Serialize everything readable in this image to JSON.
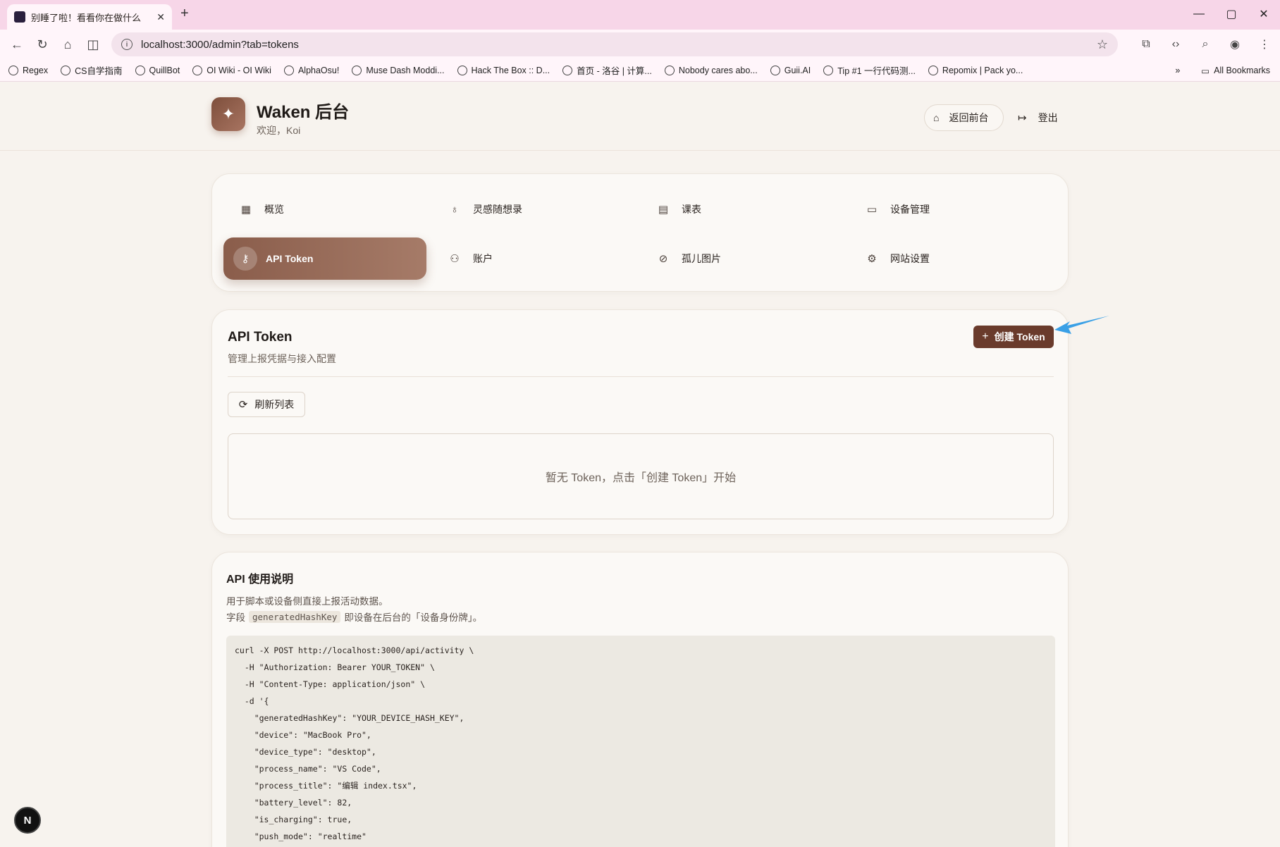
{
  "browser": {
    "tab_title": "别睡了啦！看看你在做什么",
    "url": "localhost:3000/admin?tab=tokens",
    "bookmarks": [
      "Regex",
      "CS自学指南",
      "QuillBot",
      "OI Wiki - OI Wiki",
      "AlphaOsu!",
      "Muse Dash Moddi...",
      "Hack The Box :: D...",
      "首页 - 洛谷 | 计算...",
      "Nobody cares abo...",
      "Guii.AI",
      "Tip #1 一行代码测...",
      "Repomix | Pack yo..."
    ],
    "all_bookmarks": "All Bookmarks"
  },
  "header": {
    "title": "Waken 后台",
    "subtitle": "欢迎，Koi",
    "home_label": "返回前台",
    "logout_label": "登出"
  },
  "nav": {
    "items": [
      {
        "label": "概览",
        "icon": "grid-icon"
      },
      {
        "label": "灵感随想录",
        "icon": "lightbulb-icon"
      },
      {
        "label": "课表",
        "icon": "calendar-icon"
      },
      {
        "label": "设备管理",
        "icon": "devices-icon"
      },
      {
        "label": "API Token",
        "icon": "key-icon",
        "active": true
      },
      {
        "label": "账户",
        "icon": "user-icon"
      },
      {
        "label": "孤儿图片",
        "icon": "image-off-icon"
      },
      {
        "label": "网站设置",
        "icon": "gear-icon"
      }
    ]
  },
  "tokens": {
    "title": "API Token",
    "subtitle": "管理上报凭据与接入配置",
    "create_label": "创建 Token",
    "refresh_label": "刷新列表",
    "empty_text": "暂无 Token，点击「创建 Token」开始"
  },
  "api": {
    "title": "API 使用说明",
    "line1": "用于脚本或设备侧直接上报活动数据。",
    "line2_prefix": "字段",
    "line2_code": "generatedHashKey",
    "line2_suffix": "即设备在后台的「设备身份牌」。",
    "code_lines": [
      "curl -X POST http://localhost:3000/api/activity \\",
      "  -H \"Authorization: Bearer YOUR_TOKEN\" \\",
      "  -H \"Content-Type: application/json\" \\",
      "  -d '{",
      "    \"generatedHashKey\": \"YOUR_DEVICE_HASH_KEY\",",
      "    \"device\": \"MacBook Pro\",",
      "    \"device_type\": \"desktop\",",
      "    \"process_name\": \"VS Code\",",
      "    \"process_title\": \"编辑 index.tsx\",",
      "    \"battery_level\": 82,",
      "    \"is_charging\": true,",
      "    \"push_mode\": \"realtime\""
    ]
  },
  "dev_badge": "N",
  "colors": {
    "accent": "#6a3b2c",
    "active_nav": "#8a5d4b",
    "annotation_arrow": "#3aa0e6"
  }
}
